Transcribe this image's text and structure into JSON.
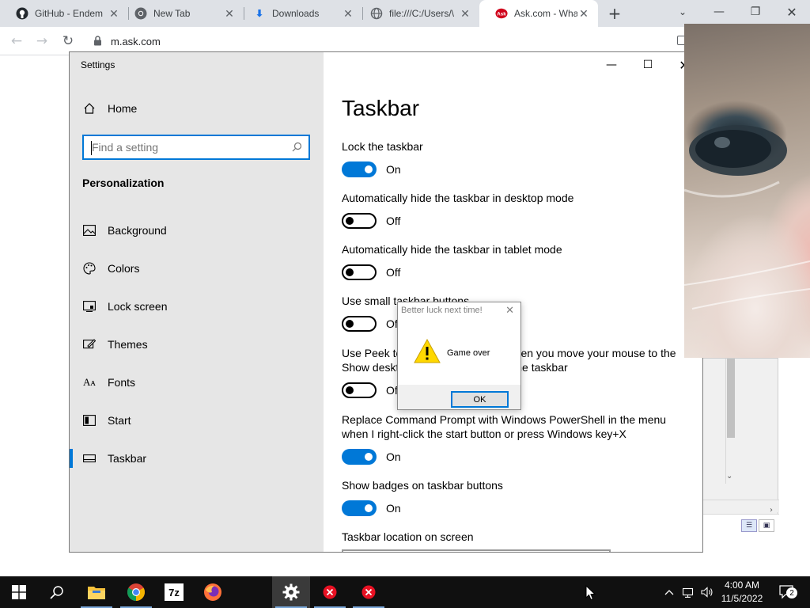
{
  "browser": {
    "tabs": [
      {
        "title": "GitHub - Endem",
        "icon": "github-icon"
      },
      {
        "title": "New Tab",
        "icon": "chrome-icon"
      },
      {
        "title": "Downloads",
        "icon": "download-icon"
      },
      {
        "title": "file:///C:/Users/\\",
        "icon": "globe-icon"
      },
      {
        "title": "Ask.com - What",
        "icon": "ask-icon",
        "active": true
      }
    ],
    "url": "m.ask.com"
  },
  "settings": {
    "window_title": "Settings",
    "home_label": "Home",
    "search_placeholder": "Find a setting",
    "section_title": "Personalization",
    "nav_items": [
      {
        "label": "Background",
        "icon": "picture-icon"
      },
      {
        "label": "Colors",
        "icon": "palette-icon"
      },
      {
        "label": "Lock screen",
        "icon": "lock-screen-icon"
      },
      {
        "label": "Themes",
        "icon": "themes-icon"
      },
      {
        "label": "Fonts",
        "icon": "fonts-icon"
      },
      {
        "label": "Start",
        "icon": "start-icon"
      },
      {
        "label": "Taskbar",
        "icon": "taskbar-icon",
        "selected": true
      }
    ],
    "page_title": "Taskbar",
    "options": [
      {
        "label": "Lock the taskbar",
        "state": "On"
      },
      {
        "label": "Automatically hide the taskbar in desktop mode",
        "state": "Off"
      },
      {
        "label": "Automatically hide the taskbar in tablet mode",
        "state": "Off"
      },
      {
        "label": "Use small taskbar buttons",
        "state": "Off"
      },
      {
        "label": "Use Peek to preview the desktop when you move your mouse to the Show desktop button at the end of the taskbar",
        "state": "Off"
      },
      {
        "label": "Replace Command Prompt with Windows PowerShell in the menu when I right-click the start button or press Windows key+X",
        "state": "On"
      },
      {
        "label": "Show badges on taskbar buttons",
        "state": "On"
      }
    ],
    "location_label": "Taskbar location on screen"
  },
  "dialog": {
    "title": "Better luck next time!",
    "message": "Game over",
    "ok_label": "OK"
  },
  "taskbar": {
    "time": "4:00 AM",
    "date": "11/5/2022",
    "notification_count": "2"
  },
  "colors": {
    "accent": "#0078d7",
    "taskbar": "#101010"
  }
}
